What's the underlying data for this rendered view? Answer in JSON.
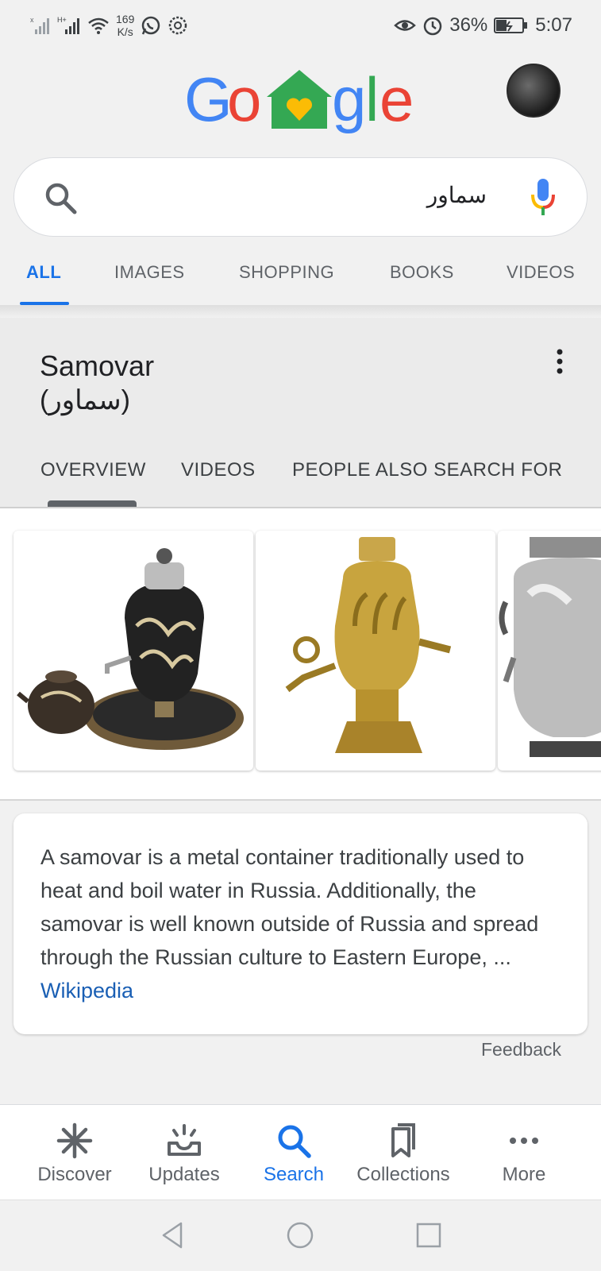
{
  "status_bar": {
    "speed_value": "169",
    "speed_unit": "K/s",
    "battery": "36%",
    "time": "5:07",
    "icons": [
      "signal-x-icon",
      "signal-h-icon",
      "wifi-icon",
      "whatsapp-icon",
      "settings-icon",
      "eye-icon",
      "alarm-icon",
      "battery-charging-icon"
    ]
  },
  "header": {
    "logo_text": "Google",
    "logo_colors": [
      "#4285F4",
      "#EA4335",
      "#34A853",
      "#FBBC05",
      "#4285F4",
      "#34A853",
      "#EA4335"
    ]
  },
  "search": {
    "query": "سماور"
  },
  "tabs": [
    {
      "label": "ALL",
      "active": true
    },
    {
      "label": "IMAGES"
    },
    {
      "label": "SHOPPING"
    },
    {
      "label": "BOOKS"
    },
    {
      "label": "VIDEOS"
    }
  ],
  "knowledge_panel": {
    "title": "Samovar",
    "subtitle": "(سماور)",
    "tabs": [
      "OVERVIEW",
      "VIDEOS",
      "PEOPLE ALSO SEARCH FOR"
    ]
  },
  "description": {
    "text": "A samovar is a metal container traditionally used to heat and boil water in Russia. Additionally, the samovar is well known outside of Russia and spread through the Russian culture to Eastern Europe, ... ",
    "source_link": "Wikipedia"
  },
  "feedback_label": "Feedback",
  "bottom_nav": [
    {
      "label": "Discover",
      "icon": "asterisk-icon"
    },
    {
      "label": "Updates",
      "icon": "inbox-icon"
    },
    {
      "label": "Search",
      "icon": "search-icon",
      "active": true
    },
    {
      "label": "Collections",
      "icon": "collections-icon"
    },
    {
      "label": "More",
      "icon": "more-dots-icon"
    }
  ],
  "colors": {
    "accent": "#1a73e8",
    "link": "#1a5fb4"
  }
}
